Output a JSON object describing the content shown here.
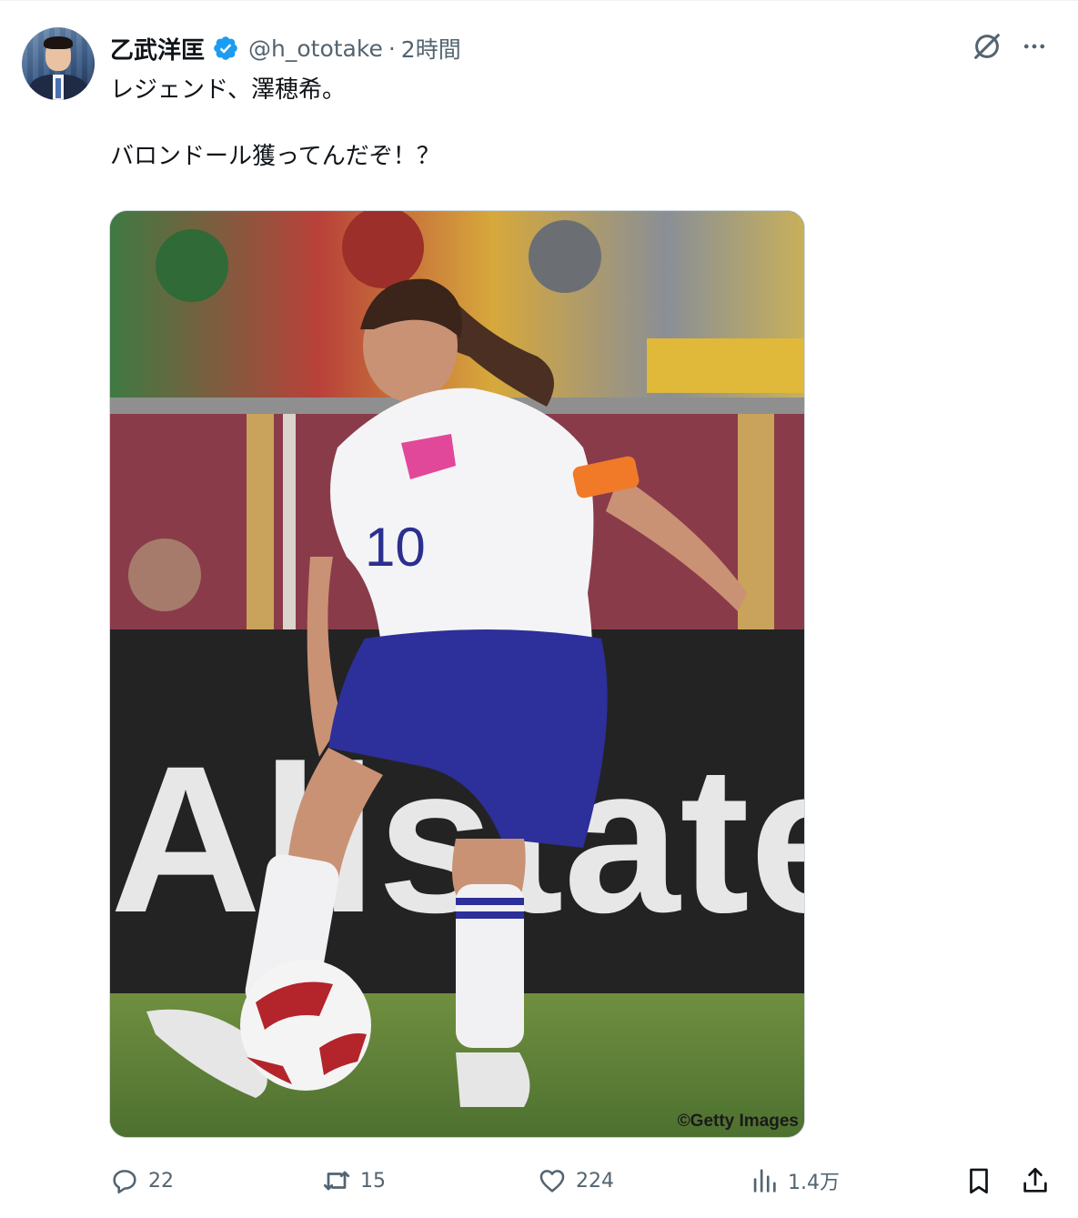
{
  "tweet": {
    "author_name": "乙武洋匡",
    "handle": "@h_ototake",
    "separator": "·",
    "time": "2時間",
    "text_line1": "レジェンド、澤穂希。",
    "text_line2": "バロンドール獲ってんだぞ！？",
    "media": {
      "credit": "©Getty Images",
      "banner_text": "Allstate",
      "jersey_number": "10"
    }
  },
  "actions": {
    "replies": "22",
    "reposts": "15",
    "likes": "224",
    "views": "1.4万"
  },
  "icons": {
    "verified": "verified-badge-icon",
    "grok": "grok-icon",
    "more": "more-icon",
    "reply": "reply-icon",
    "repost": "repost-icon",
    "like": "heart-icon",
    "views": "views-icon",
    "bookmark": "bookmark-icon",
    "share": "share-icon"
  },
  "colors": {
    "verified_blue": "#1d9bf0",
    "secondary_text": "#536471",
    "primary_text": "#0f1419"
  }
}
